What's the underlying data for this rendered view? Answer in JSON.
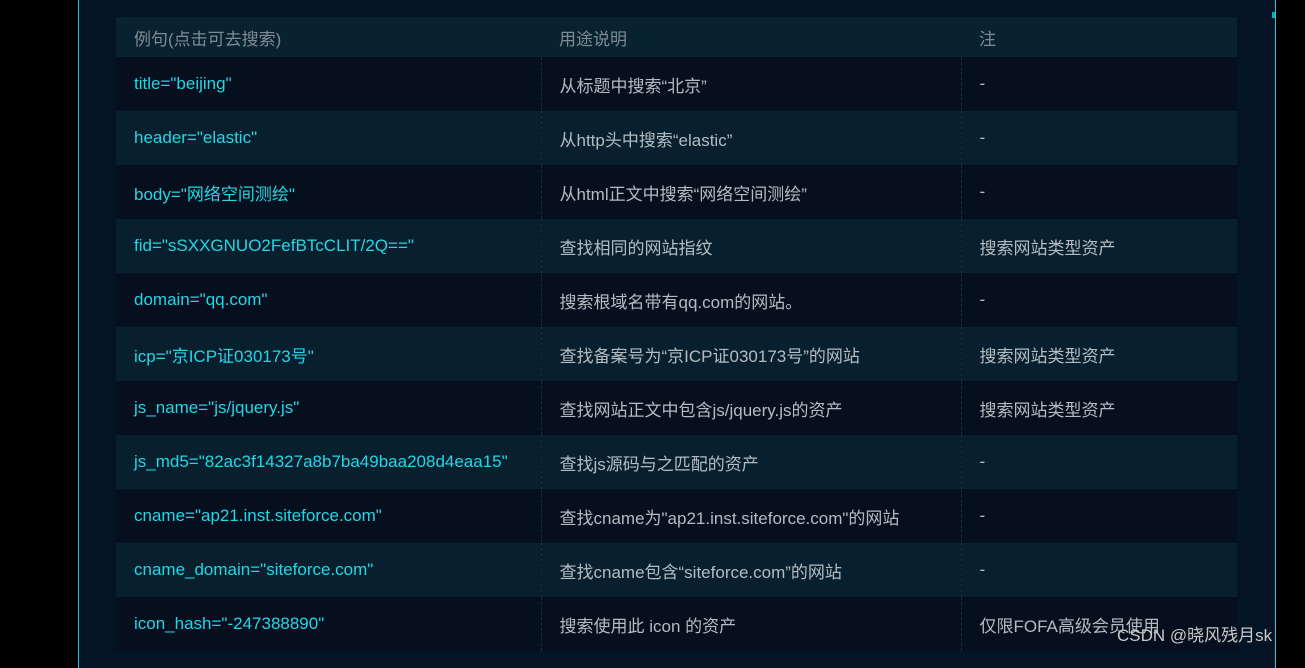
{
  "table": {
    "headers": {
      "example": "例句(点击可去搜索)",
      "description": "用途说明",
      "note": "注"
    },
    "rows": [
      {
        "example": "title=\"beijing\"",
        "description": "从标题中搜索“北京”",
        "note": "-"
      },
      {
        "example": "header=\"elastic\"",
        "description": "从http头中搜索“elastic”",
        "note": "-"
      },
      {
        "example": "body=\"网络空间测绘\"",
        "description": "从html正文中搜索“网络空间测绘”",
        "note": "-"
      },
      {
        "example": "fid=\"sSXXGNUO2FefBTcCLIT/2Q==\"",
        "description": "查找相同的网站指纹",
        "note": "搜索网站类型资产"
      },
      {
        "example": "domain=\"qq.com\"",
        "description": "搜索根域名带有qq.com的网站。",
        "note": "-"
      },
      {
        "example": "icp=\"京ICP证030173号\"",
        "description": "查找备案号为“京ICP证030173号”的网站",
        "note": "搜索网站类型资产"
      },
      {
        "example": "js_name=\"js/jquery.js\"",
        "description": "查找网站正文中包含js/jquery.js的资产",
        "note": "搜索网站类型资产"
      },
      {
        "example": "js_md5=\"82ac3f14327a8b7ba49baa208d4eaa15\"",
        "description": "查找js源码与之匹配的资产",
        "note": "-"
      },
      {
        "example": "cname=\"ap21.inst.siteforce.com\"",
        "description": "查找cname为\"ap21.inst.siteforce.com\"的网站",
        "note": "-"
      },
      {
        "example": "cname_domain=\"siteforce.com\"",
        "description": "查找cname包含“siteforce.com”的网站",
        "note": "-"
      },
      {
        "example": "icon_hash=\"-247388890\"",
        "description": "搜索使用此 icon 的资产",
        "note": "仅限FOFA高级会员使用"
      }
    ]
  },
  "watermark": "CSDN @晓风残月sk",
  "colors": {
    "page_background": "#000000",
    "panel_background": "#051424",
    "panel_border": "#1bc6dc",
    "example_link": "#22d6e6",
    "header_text": "#7f8b93",
    "body_text": "#b4bcc2"
  }
}
